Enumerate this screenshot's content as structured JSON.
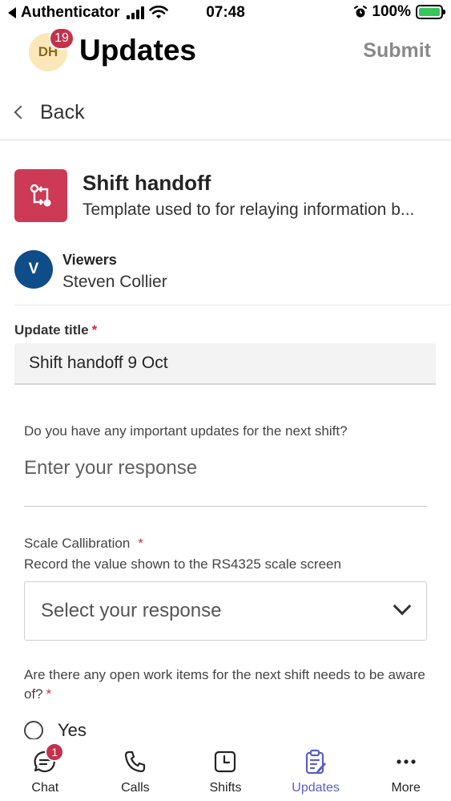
{
  "status_bar": {
    "back_app": "Authenticator",
    "time": "07:48",
    "battery": "100%",
    "icons": [
      "back-triangle-icon",
      "signal-icon",
      "wifi-icon",
      "alarm-icon",
      "battery-charging-icon"
    ]
  },
  "header": {
    "avatar_initials": "DH",
    "notification_count": "19",
    "title": "Updates",
    "submit_label": "Submit"
  },
  "nav": {
    "back_label": "Back"
  },
  "template": {
    "title": "Shift handoff",
    "description": "Template used to for relaying information b...",
    "icon": "swap-arrows-icon"
  },
  "viewers": {
    "label": "Viewers",
    "avatar_initial": "V",
    "name": "Steven Collier"
  },
  "form": {
    "update_title_label": "Update title",
    "required_mark": "*",
    "update_title_value": "Shift handoff 9 Oct",
    "q1_text": "Do you have any important updates for the next shift?",
    "q1_placeholder": "Enter your response",
    "q2_text": "Scale Callibration",
    "q2_subtext": "Record the value shown to the RS4325 scale screen",
    "q2_placeholder": "Select your response",
    "q3_text": "Are there any open work items for the next shift needs to be aware of?",
    "q3_option_yes": "Yes"
  },
  "tabs": [
    {
      "label": "Chat",
      "icon": "chat-icon",
      "badge": "1"
    },
    {
      "label": "Calls",
      "icon": "phone-icon"
    },
    {
      "label": "Shifts",
      "icon": "clock-icon"
    },
    {
      "label": "Updates",
      "icon": "clipboard-icon",
      "active": true
    },
    {
      "label": "More",
      "icon": "more-icon"
    }
  ],
  "colors": {
    "accent": "#5b5fc7",
    "template_icon_bg": "#cc3a55",
    "badge": "#c4314b",
    "viewer_avatar": "#0f4c8a",
    "user_avatar": "#fbe7b9"
  }
}
